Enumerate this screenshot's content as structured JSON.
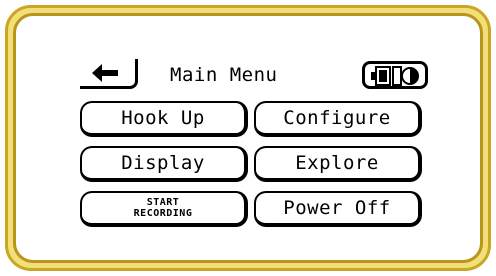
{
  "header": {
    "title": "Main Menu"
  },
  "menu": {
    "hook_up": "Hook Up",
    "configure": "Configure",
    "display": "Display",
    "explore": "Explore",
    "start_recording_line1": "START",
    "start_recording_line2": "RECORDING",
    "power_off": "Power Off"
  },
  "colors": {
    "frame_outer": "#c9a623",
    "frame_fill": "#f3df7a",
    "frame_inner": "#b8961c"
  },
  "icons": {
    "back": "left-arrow-icon",
    "battery": "battery-icon"
  }
}
